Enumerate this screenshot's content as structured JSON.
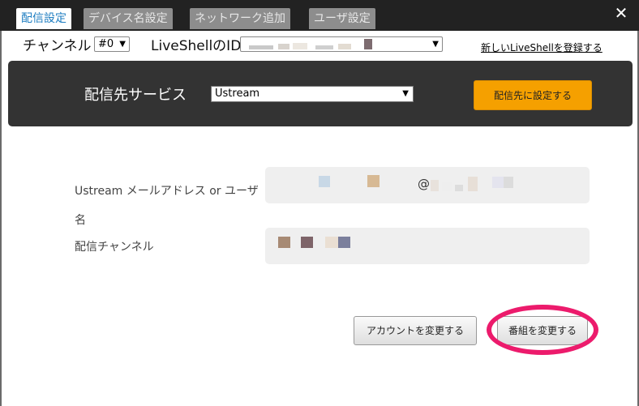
{
  "tabs": [
    {
      "label": "配信設定",
      "active": true
    },
    {
      "label": "デバイス名設定",
      "active": false
    },
    {
      "label": "ネットワーク追加",
      "active": false
    },
    {
      "label": "ユーザ設定",
      "active": false
    }
  ],
  "close_label": "✕",
  "channel": {
    "label": "チャンネル",
    "value": "#0"
  },
  "liveshell": {
    "label": "LiveShellのID"
  },
  "register_link": "新しいLiveShellを登録する",
  "service": {
    "label": "配信先サービス",
    "value": "Ustream",
    "set_button": "配信先に設定する"
  },
  "fields": {
    "email_label": "Ustream メールアドレス or ユーザ名",
    "email_label_line1": "Ustream メールアドレス or ユーザ",
    "email_label_line2": "名",
    "email_at": "@",
    "channel_label": "配信チャンネル"
  },
  "buttons": {
    "change_account": "アカウントを変更する",
    "change_program": "番組を変更する"
  },
  "colors": {
    "accent": "#f5a000",
    "tab_active_text": "#1f7ec1",
    "highlight_ring": "#ec1b6c"
  }
}
